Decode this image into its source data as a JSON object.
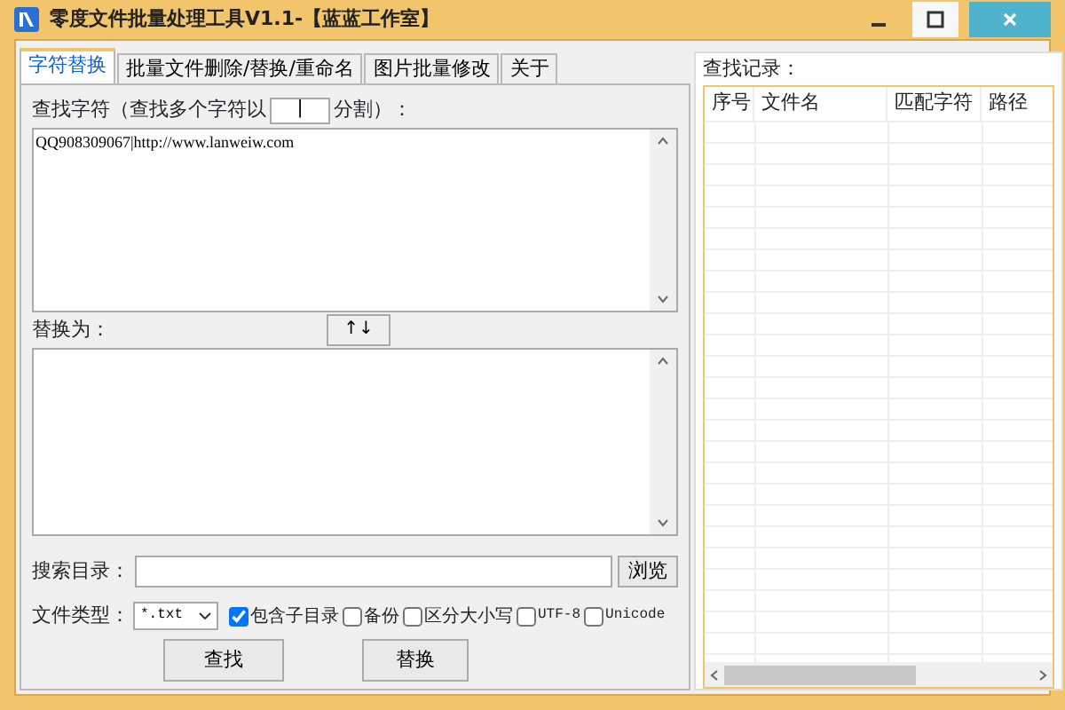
{
  "window": {
    "title": "零度文件批量处理工具V1.1-【蓝蓝工作室】"
  },
  "tabs": [
    {
      "label": "字符替换",
      "selected": true
    },
    {
      "label": "批量文件删除/替换/重命名",
      "selected": false
    },
    {
      "label": "图片批量修改",
      "selected": false
    },
    {
      "label": "关于",
      "selected": false
    }
  ],
  "find": {
    "label": "查找字符（查找多个字符以",
    "delimiter": "|",
    "label_end": "分割）：",
    "text": "QQ908309067|http://www.lanweiw.com"
  },
  "swap_button": "↑↓",
  "replace": {
    "label": "替换为："
  },
  "directory": {
    "label": "搜索目录：",
    "browse": "浏览"
  },
  "file_type": {
    "label": "文件类型：",
    "value": "*.txt"
  },
  "options": [
    {
      "label": "包含子目录",
      "checked": true
    },
    {
      "label": "备份",
      "checked": false
    },
    {
      "label": "区分大小写",
      "checked": false
    },
    {
      "label": "UTF-8",
      "checked": false
    },
    {
      "label": "Unicode",
      "checked": false
    }
  ],
  "actions": [
    "查找",
    "替换"
  ],
  "results": {
    "label": "查找记录：",
    "columns": [
      "序号",
      "文件名",
      "匹配字符",
      "路径"
    ]
  }
}
